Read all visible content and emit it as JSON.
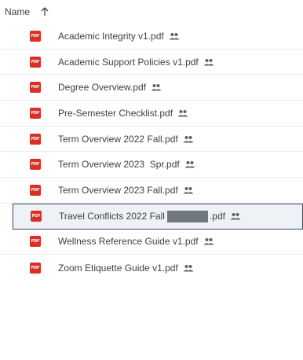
{
  "header": {
    "name_label": "Name",
    "sort_icon": "arrow-up-icon"
  },
  "files": [
    {
      "name": "Academic Integrity v1.pdf",
      "shared": true
    },
    {
      "name": "Academic Support Policies v1.pdf",
      "shared": true
    },
    {
      "name": "Degree Overview.pdf",
      "shared": true
    },
    {
      "name": "Pre-Semester Checklist.pdf",
      "shared": true
    },
    {
      "name": "Term Overview 2022 Fall.pdf",
      "shared": true
    },
    {
      "name": "Term Overview 2023  Spr.pdf",
      "shared": true
    },
    {
      "name": "Term Overview 2023 Fall.pdf",
      "shared": true
    },
    {
      "name_part1": "Travel Conflicts 2022 Fall",
      "name_part2": ".pdf",
      "redacted": true,
      "selected": true,
      "shared": true
    },
    {
      "name": "Wellness Reference Guide v1.pdf",
      "shared": true
    },
    {
      "name": "Zoom Etiquette Guide v1.pdf",
      "shared": true
    }
  ],
  "icons": {
    "file_type": "PDF",
    "file_icon": "pdf-icon",
    "shared_icon": "shared-people-icon"
  },
  "colors": {
    "pdf_red": "#d93025",
    "selected_border": "#3c4a5a",
    "redaction": "#707780"
  }
}
